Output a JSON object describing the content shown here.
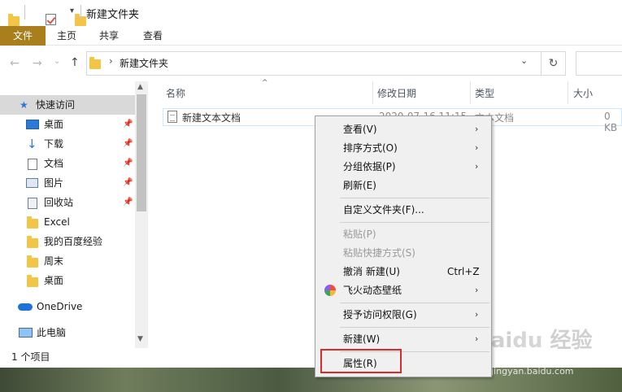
{
  "window": {
    "title": "新建文件夹"
  },
  "ribbon": {
    "tabs": [
      "文件",
      "主页",
      "共享",
      "查看"
    ]
  },
  "address": {
    "path": "新建文件夹",
    "chevron": "›",
    "dropdown": "⌄",
    "refresh": "↻"
  },
  "nav": {
    "back": "←",
    "forward": "→",
    "recent": "⌄",
    "up": "↑",
    "items": [
      {
        "label": "快速访问",
        "icon": "star-icon",
        "pinned": false
      },
      {
        "label": "桌面",
        "icon": "desktop-icon",
        "pinned": true
      },
      {
        "label": "下载",
        "icon": "download-icon",
        "pinned": true
      },
      {
        "label": "文档",
        "icon": "documents-icon",
        "pinned": true
      },
      {
        "label": "图片",
        "icon": "pictures-icon",
        "pinned": true
      },
      {
        "label": "回收站",
        "icon": "recycle-bin-icon",
        "pinned": true
      },
      {
        "label": "Excel",
        "icon": "folder-icon",
        "pinned": false
      },
      {
        "label": "我的百度经验",
        "icon": "folder-icon",
        "pinned": false
      },
      {
        "label": "周末",
        "icon": "folder-icon",
        "pinned": false
      },
      {
        "label": "桌面",
        "icon": "folder-icon",
        "pinned": false
      },
      {
        "label": "OneDrive",
        "icon": "cloud-icon",
        "pinned": false
      },
      {
        "label": "此电脑",
        "icon": "computer-icon",
        "pinned": false
      }
    ]
  },
  "columns": {
    "name": "名称",
    "modified": "修改日期",
    "type": "类型",
    "size": "大小"
  },
  "files": [
    {
      "name": "新建文本文档",
      "modified": "2020-07-16 11:15",
      "type": "文本文档",
      "size": "0 KB"
    }
  ],
  "status": {
    "count": "1 个项目"
  },
  "context_menu": {
    "items": [
      {
        "label": "查看(V)",
        "submenu": true,
        "disabled": false
      },
      {
        "label": "排序方式(O)",
        "submenu": true,
        "disabled": false
      },
      {
        "label": "分组依据(P)",
        "submenu": true,
        "disabled": false
      },
      {
        "label": "刷新(E)",
        "submenu": false,
        "disabled": false
      },
      {
        "label": "自定义文件夹(F)...",
        "submenu": false,
        "disabled": false
      },
      {
        "label": "粘贴(P)",
        "submenu": false,
        "disabled": true
      },
      {
        "label": "粘贴快捷方式(S)",
        "submenu": false,
        "disabled": true
      },
      {
        "label": "撤消 新建(U)",
        "shortcut": "Ctrl+Z",
        "submenu": false,
        "disabled": false
      },
      {
        "label": "飞火动态壁纸",
        "submenu": true,
        "disabled": false
      },
      {
        "label": "授予访问权限(G)",
        "submenu": true,
        "disabled": false
      },
      {
        "label": "新建(W)",
        "submenu": true,
        "disabled": false
      },
      {
        "label": "属性(R)",
        "submenu": false,
        "disabled": false
      }
    ],
    "submenu_arrow": "›"
  },
  "watermark": {
    "logo": "Baidu经验",
    "url": "jingyan.baidu.com"
  },
  "colors": {
    "file_tab": "#a97e1c",
    "selection": "#d9d9d9",
    "highlight_box": "#d92b2b",
    "folder": "#f3c546"
  }
}
